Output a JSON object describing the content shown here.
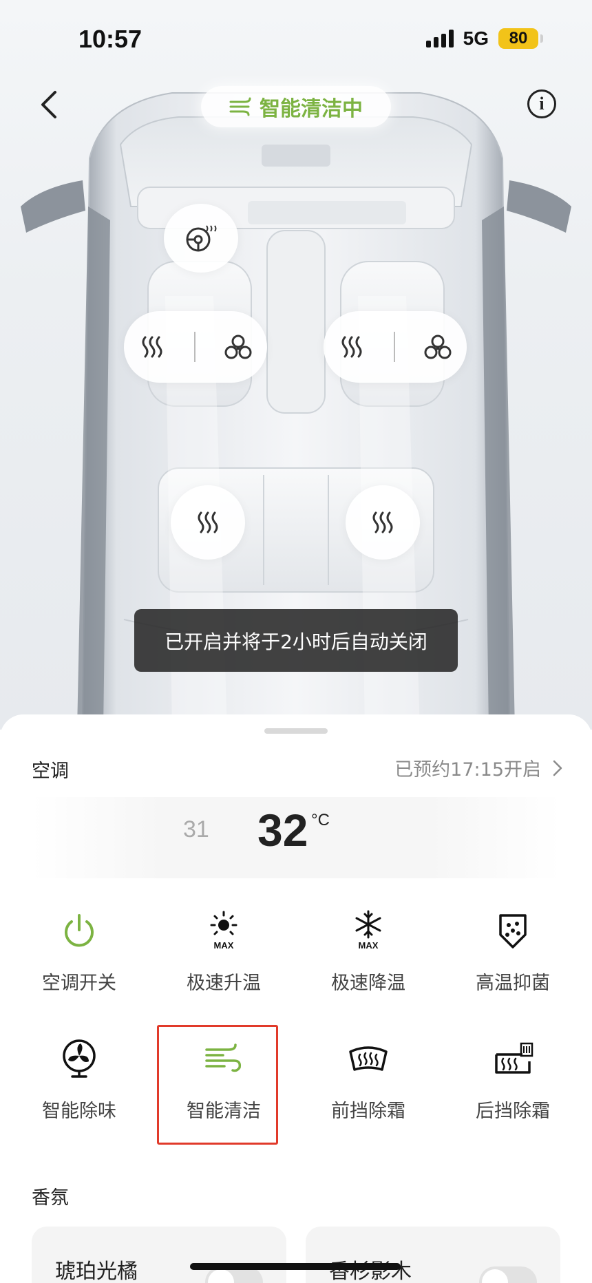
{
  "status_bar": {
    "time": "10:57",
    "network": "5G",
    "battery": "80"
  },
  "header": {
    "status_label": "智能清洁中"
  },
  "toast": {
    "text": "已开启并将于2小时后自动关闭"
  },
  "ac": {
    "title": "空调",
    "schedule_text": "已预约17:15开启",
    "temp_prev": "31",
    "temp_current": "32",
    "temp_unit": "°C"
  },
  "functions": [
    {
      "label": "空调开关",
      "icon": "power-icon",
      "color": "#7cb342"
    },
    {
      "label": "极速升温",
      "icon": "sun-max-icon",
      "color": "#111111"
    },
    {
      "label": "极速降温",
      "icon": "snowflake-max-icon",
      "color": "#111111"
    },
    {
      "label": "高温抑菌",
      "icon": "shield-dots-icon",
      "color": "#111111"
    },
    {
      "label": "智能除味",
      "icon": "fan-icon",
      "color": "#111111"
    },
    {
      "label": "智能清洁",
      "icon": "wind-icon",
      "color": "#7cb342",
      "active": true
    },
    {
      "label": "前挡除霜",
      "icon": "front-defrost-icon",
      "color": "#111111"
    },
    {
      "label": "后挡除霜",
      "icon": "rear-defrost-icon",
      "color": "#111111"
    }
  ],
  "fragrance": {
    "title": "香氛",
    "items": [
      {
        "name": "琥珀光橘"
      },
      {
        "name": "香杉影木"
      }
    ]
  },
  "colors": {
    "accent_green": "#7cb342",
    "highlight_red": "#e13a2a"
  }
}
